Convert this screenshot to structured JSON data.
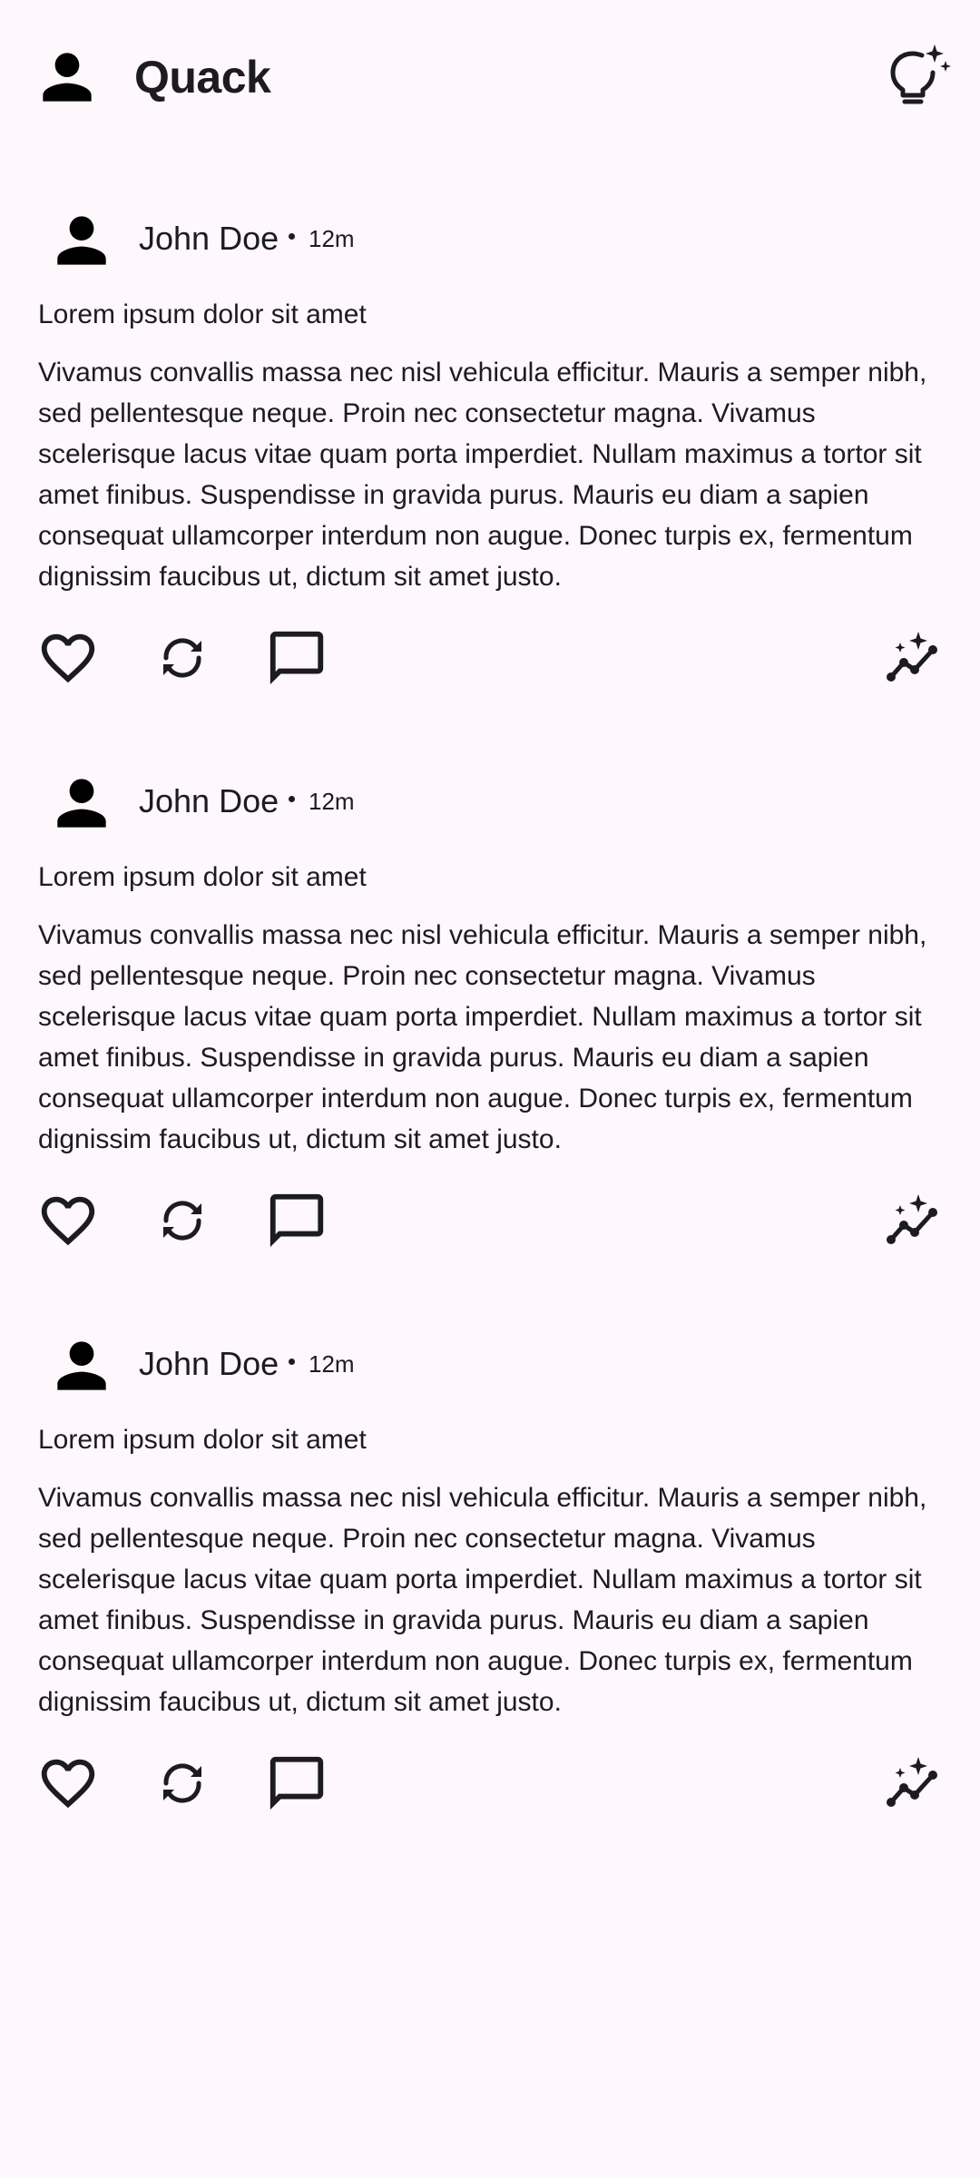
{
  "app": {
    "title": "Quack",
    "avatar_icon": "person-icon",
    "action_icon": "lightbulb-sparkle-icon"
  },
  "posts": [
    {
      "author": "John Doe",
      "time": "12m",
      "title": "Lorem ipsum dolor sit amet",
      "body": "Vivamus convallis massa nec nisl vehicula efficitur. Mauris a semper nibh, sed pellentesque neque. Proin nec consectetur magna. Vivamus scelerisque lacus vitae quam porta imperdiet. Nullam maximus a tortor sit amet finibus. Suspendisse in gravida purus. Mauris eu diam a sapien consequat ullamcorper interdum non augue. Donec turpis ex, fermentum dignissim faucibus ut, dictum sit amet justo.",
      "actions": [
        "heart-icon",
        "repost-icon",
        "comment-icon",
        "analytics-sparkle-icon"
      ]
    },
    {
      "author": "John Doe",
      "time": "12m",
      "title": "Lorem ipsum dolor sit amet",
      "body": "Vivamus convallis massa nec nisl vehicula efficitur. Mauris a semper nibh, sed pellentesque neque. Proin nec consectetur magna. Vivamus scelerisque lacus vitae quam porta imperdiet. Nullam maximus a tortor sit amet finibus. Suspendisse in gravida purus. Mauris eu diam a sapien consequat ullamcorper interdum non augue. Donec turpis ex, fermentum dignissim faucibus ut, dictum sit amet justo.",
      "actions": [
        "heart-icon",
        "repost-icon",
        "comment-icon",
        "analytics-sparkle-icon"
      ]
    },
    {
      "author": "John Doe",
      "time": "12m",
      "title": "Lorem ipsum dolor sit amet",
      "body": "Vivamus convallis massa nec nisl vehicula efficitur. Mauris a semper nibh, sed pellentesque neque. Proin nec consectetur magna. Vivamus scelerisque lacus vitae quam porta imperdiet. Nullam maximus a tortor sit amet finibus. Suspendisse in gravida purus. Mauris eu diam a sapien consequat ullamcorper interdum non augue. Donec turpis ex, fermentum dignissim faucibus ut, dictum sit amet justo.",
      "actions": [
        "heart-icon",
        "repost-icon",
        "comment-icon",
        "analytics-sparkle-icon"
      ]
    }
  ],
  "colors": {
    "background": "#fef7fb",
    "foreground": "#1c1b1f"
  }
}
